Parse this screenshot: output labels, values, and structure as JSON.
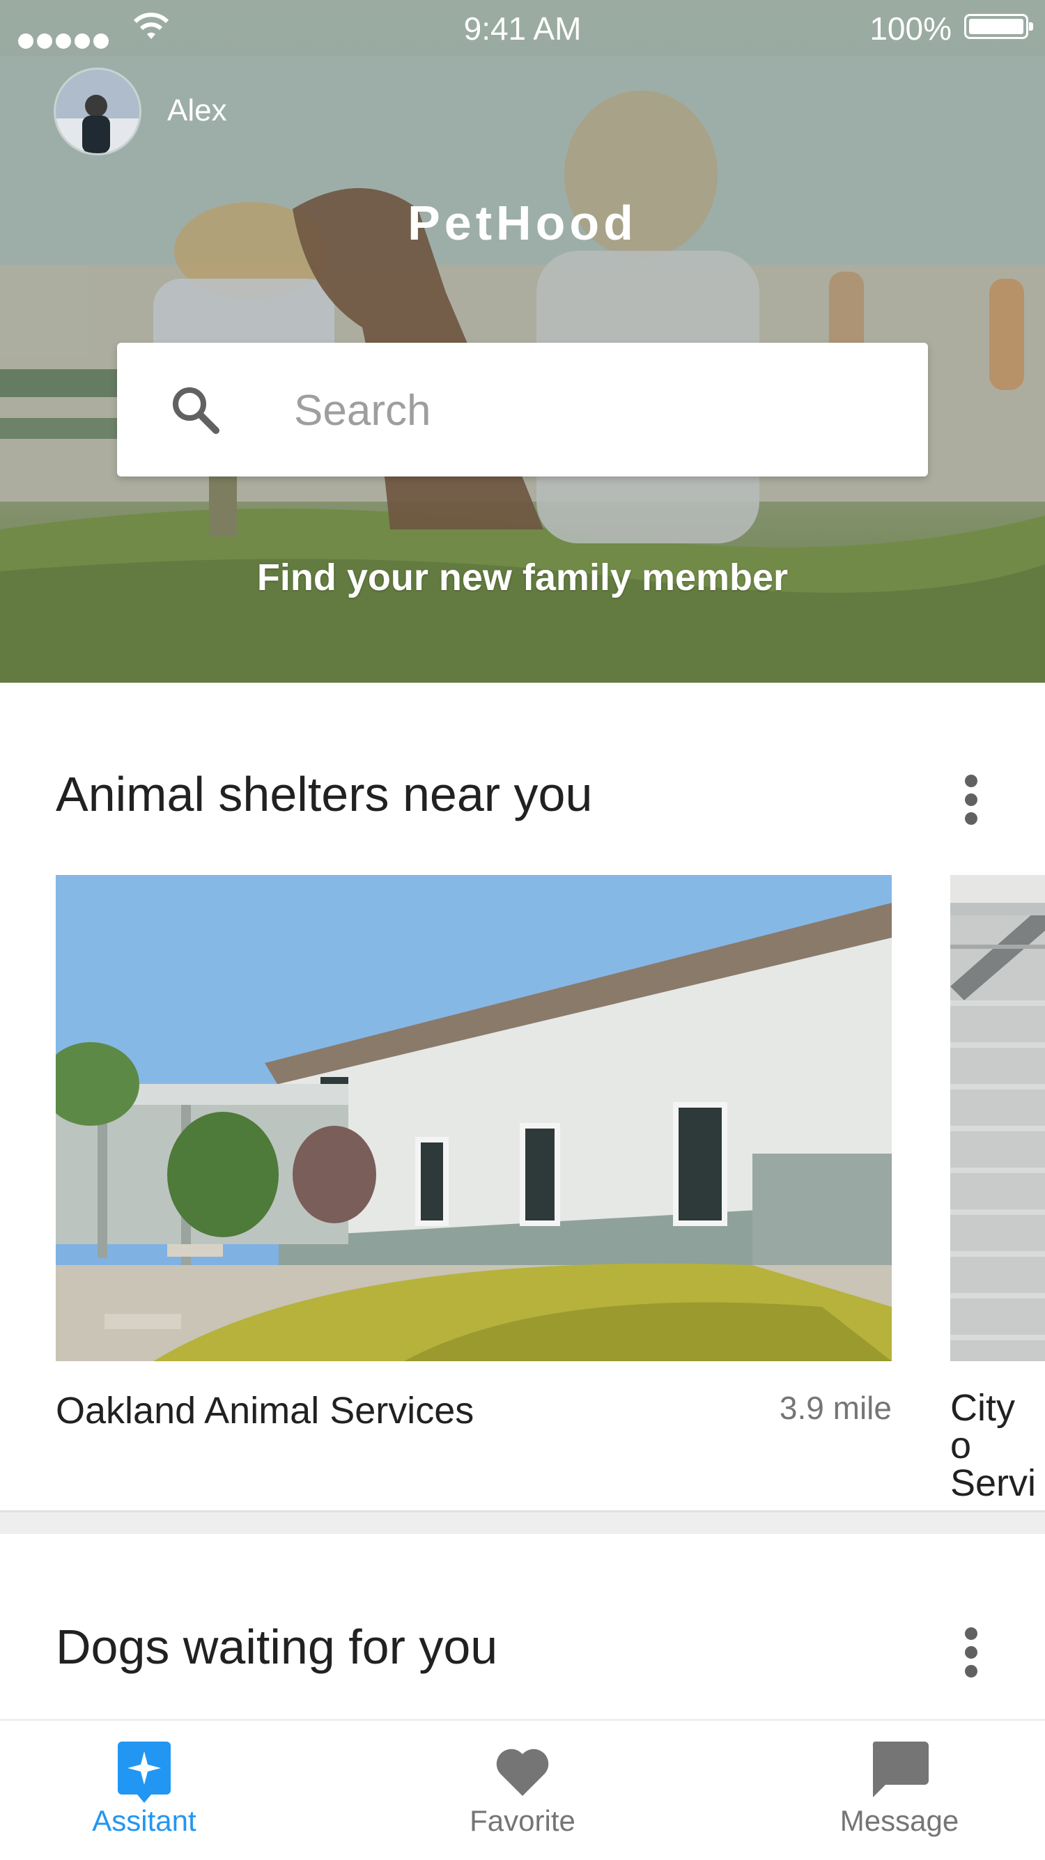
{
  "status_bar": {
    "time": "9:41 AM",
    "battery": "100%"
  },
  "header": {
    "user_name": "Alex",
    "app_title": "PetHood",
    "search_placeholder": "Search",
    "tagline": "Find your new family member"
  },
  "shelters": {
    "title": "Animal shelters near you",
    "cards": [
      {
        "name": "Oakland Animal Services",
        "distance": "3.9 mile"
      },
      {
        "name": "City o Servic",
        "distance": ""
      }
    ]
  },
  "dogs": {
    "title": "Dogs waiting for you"
  },
  "bottom_nav": {
    "items": [
      {
        "label": "Assitant",
        "icon": "assistant-icon",
        "active": true
      },
      {
        "label": "Favorite",
        "icon": "heart-icon",
        "active": false
      },
      {
        "label": "Message",
        "icon": "message-icon",
        "active": false
      }
    ]
  },
  "colors": {
    "accent": "#2196F3",
    "inactive": "#757575",
    "hero_tint": "#9fb0a8"
  }
}
